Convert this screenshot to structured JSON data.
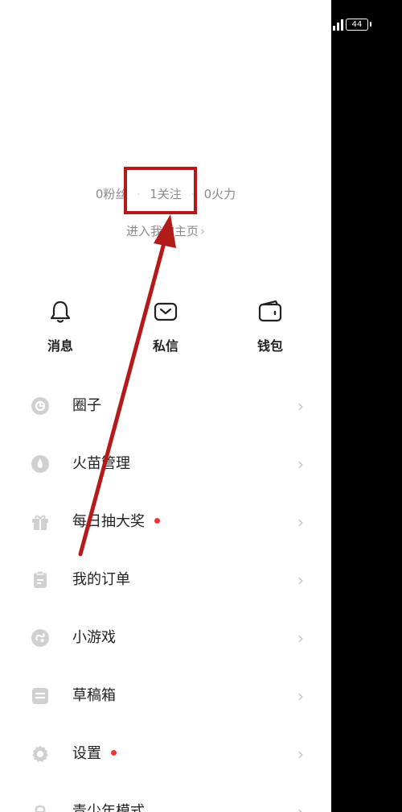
{
  "status_bar": {
    "battery_level": "44",
    "icons": [
      "signal-icon",
      "battery-icon"
    ]
  },
  "header": {
    "menu_icon": "menu-icon",
    "notification_dot_color": "#c2185b"
  },
  "profile": {
    "stats": [
      {
        "label": "0粉丝"
      },
      {
        "label": "1关注"
      },
      {
        "label": "0火力"
      }
    ],
    "separator": "·",
    "home_link": "进入我的主页",
    "home_link_chevron": "›"
  },
  "quick_actions": [
    {
      "label": "消息",
      "icon": "bell-icon"
    },
    {
      "label": "私信",
      "icon": "message-icon"
    },
    {
      "label": "钱包",
      "icon": "wallet-icon"
    }
  ],
  "menu": {
    "chevron": "›",
    "items": [
      {
        "label": "圈子",
        "icon": "circle-icon",
        "has_dot": false
      },
      {
        "label": "火苗管理",
        "icon": "flame-icon",
        "has_dot": false
      },
      {
        "label": "每日抽大奖",
        "icon": "gift-icon",
        "has_dot": true
      },
      {
        "label": "我的订单",
        "icon": "order-icon",
        "has_dot": false
      },
      {
        "label": "小游戏",
        "icon": "game-icon",
        "has_dot": false
      },
      {
        "label": "草稿箱",
        "icon": "drafts-icon",
        "has_dot": false
      },
      {
        "label": "设置",
        "icon": "settings-icon",
        "has_dot": true
      },
      {
        "label": "青少年模式",
        "icon": "lock-icon",
        "has_dot": false
      }
    ]
  },
  "annotation": {
    "color": "#b31b1b",
    "highlighted_target": "1关注"
  },
  "colors": {
    "panel_bg": "#ffffff",
    "backdrop": "#000000",
    "text_primary": "#222222",
    "text_secondary": "#8a8a8a",
    "icon_gray": "#d0d0d0",
    "red_dot": "#e53935"
  }
}
